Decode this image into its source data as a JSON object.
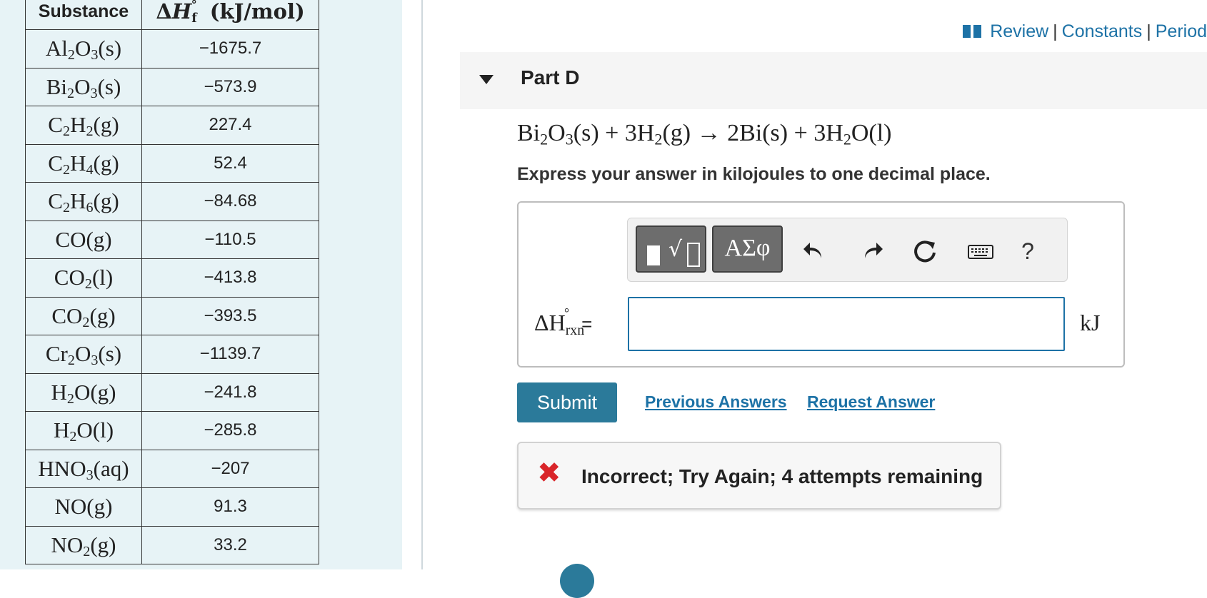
{
  "table": {
    "header_substance": "Substance",
    "header_enthalpy": "ΔH°f (kJ/mol)",
    "rows": [
      {
        "formula": "Al2O3(s)",
        "value": "−1675.7"
      },
      {
        "formula": "Bi2O3(s)",
        "value": "−573.9"
      },
      {
        "formula": "C2H2(g)",
        "value": "227.4"
      },
      {
        "formula": "C2H4(g)",
        "value": "52.4"
      },
      {
        "formula": "C2H6(g)",
        "value": "−84.68"
      },
      {
        "formula": "CO(g)",
        "value": "−110.5"
      },
      {
        "formula": "CO2(l)",
        "value": "−413.8"
      },
      {
        "formula": "CO2(g)",
        "value": "−393.5"
      },
      {
        "formula": "Cr2O3(s)",
        "value": "−1139.7"
      },
      {
        "formula": "H2O(g)",
        "value": "−241.8"
      },
      {
        "formula": "H2O(l)",
        "value": "−285.8"
      },
      {
        "formula": "HNO3(aq)",
        "value": "−207"
      },
      {
        "formula": "NO(g)",
        "value": "91.3"
      },
      {
        "formula": "NO2(g)",
        "value": "33.2"
      }
    ]
  },
  "links": {
    "review": "Review",
    "constants": "Constants",
    "periodic": "Period",
    "separator": "|"
  },
  "part": {
    "title": "Part D"
  },
  "equation": "Bi2O3(s) + 3H2(g) → 2Bi(s) + 3H2O(l)",
  "instruction": "Express your answer in kilojoules to one decimal place.",
  "toolbar": {
    "symbols_label": "ΑΣφ",
    "help_label": "?"
  },
  "answer": {
    "label_symbol": "ΔH",
    "label_sub": "rxn",
    "label_degree": "°",
    "equals": "=",
    "value": "",
    "unit": "kJ"
  },
  "actions": {
    "submit": "Submit",
    "previous_answers": "Previous Answers",
    "request_answer": "Request Answer"
  },
  "feedback": {
    "text": "Incorrect; Try Again; 4 attempts remaining"
  },
  "colors": {
    "accent": "#1d72a6",
    "submit": "#2b7a9a",
    "error": "#d9252a",
    "panel": "#e7f3f6"
  }
}
